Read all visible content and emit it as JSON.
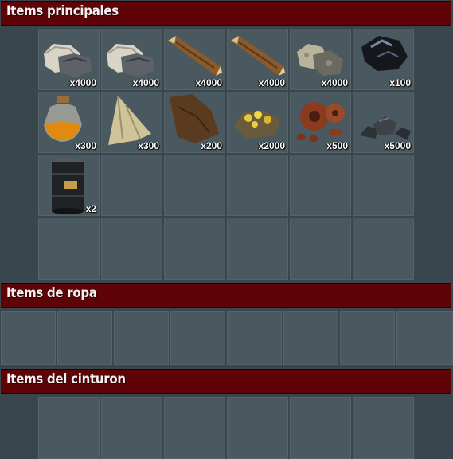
{
  "sections": {
    "main": {
      "title": "Items principales"
    },
    "clothing": {
      "title": "Items de ropa"
    },
    "belt": {
      "title": "Items del cinturon"
    }
  },
  "main_items": [
    {
      "name": "stone-icon",
      "qty": "x4000"
    },
    {
      "name": "stone-icon",
      "qty": "x4000"
    },
    {
      "name": "wood-icon",
      "qty": "x4000"
    },
    {
      "name": "wood-icon",
      "qty": "x4000"
    },
    {
      "name": "metal-ore-icon",
      "qty": "x4000"
    },
    {
      "name": "coal-icon",
      "qty": "x100"
    },
    {
      "name": "low-grade-fuel-icon",
      "qty": "x300"
    },
    {
      "name": "cloth-icon",
      "qty": "x300"
    },
    {
      "name": "leather-icon",
      "qty": "x200"
    },
    {
      "name": "sulfur-ore-icon",
      "qty": "x2000"
    },
    {
      "name": "gears-icon",
      "qty": "x500"
    },
    {
      "name": "metal-fragments-icon",
      "qty": "x5000"
    },
    {
      "name": "oil-barrel-icon",
      "qty": "x2"
    }
  ],
  "colors": {
    "header_bg": "#5e0406",
    "slot_bg": "#4a5860",
    "page_bg": "#3a464e"
  }
}
